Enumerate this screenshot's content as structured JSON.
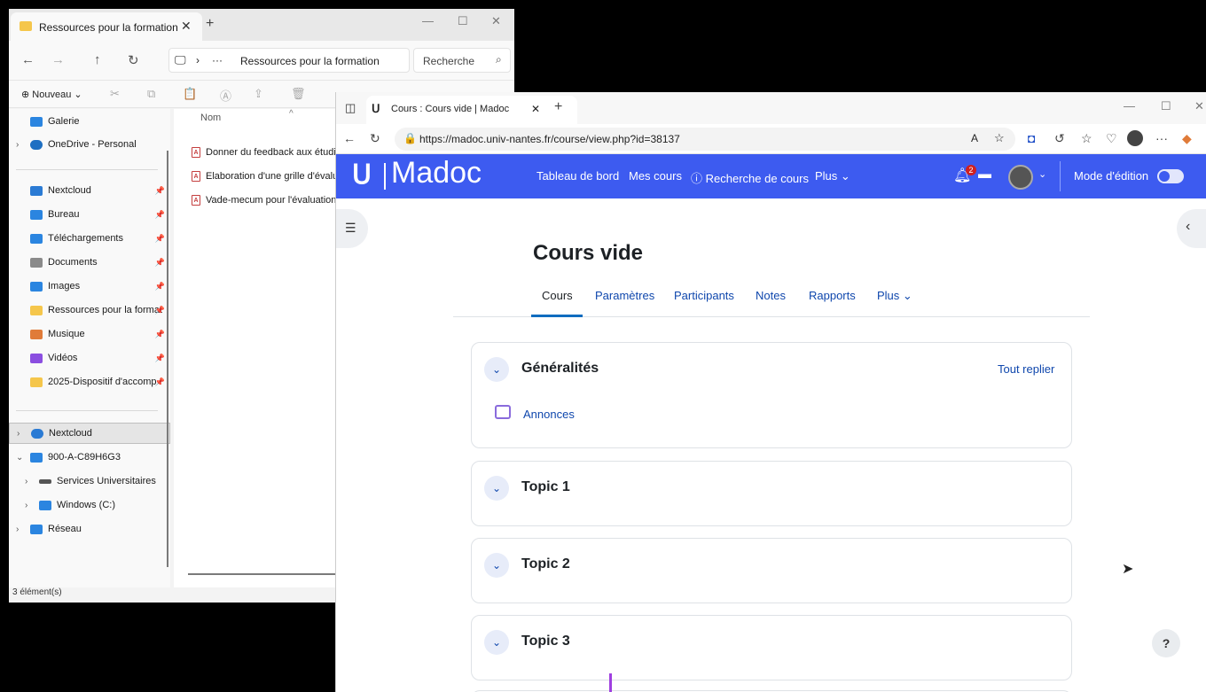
{
  "explorer": {
    "tab_title": "Ressources pour la formation",
    "breadcrumb": "Ressources pour la formation",
    "search_placeholder": "Recherche",
    "toolbar": {
      "new_label": "Nouveau"
    },
    "sidebar": {
      "gallery": "Galerie",
      "onedrive": "OneDrive - Personal",
      "quick": [
        {
          "label": "Nextcloud",
          "color": "#2b7bd4"
        },
        {
          "label": "Bureau",
          "color": "#2b85e0"
        },
        {
          "label": "Téléchargements",
          "color": "#2b85e0"
        },
        {
          "label": "Documents",
          "color": "#8a8a8a"
        },
        {
          "label": "Images",
          "color": "#2b85e0"
        },
        {
          "label": "Ressources pour la format",
          "color": "#f5c64b"
        },
        {
          "label": "Musique",
          "color": "#e07b39"
        },
        {
          "label": "Vidéos",
          "color": "#8b4ee0"
        },
        {
          "label": "2025-Dispositif d'accomp",
          "color": "#f5c64b"
        }
      ],
      "tree": {
        "nextcloud": "Nextcloud",
        "pc": "900-A-C89H6G3",
        "services": "Services Universitaires",
        "windows": "Windows (C:)",
        "network": "Réseau"
      }
    },
    "column_header": "Nom",
    "files": [
      "Donner du feedback aux étudian",
      "Elaboration d'une grille d'évalua",
      "Vade-mecum pour l'évaluation à"
    ],
    "status": "3 élément(s)"
  },
  "browser": {
    "tab_title": "Cours : Cours vide | Madoc",
    "url": "https://madoc.univ-nantes.fr/course/view.php?id=38137"
  },
  "madoc": {
    "logo_mark": "ᑌ",
    "logo_text": "Madoc",
    "nav": {
      "dashboard": "Tableau de bord",
      "my_courses": "Mes cours",
      "course_search": "Recherche de cours",
      "more": "Plus ⌄"
    },
    "notif_count": "2",
    "edit_mode": "Mode d'édition",
    "course_title": "Cours vide",
    "tabs": [
      "Cours",
      "Paramètres",
      "Participants",
      "Notes",
      "Rapports",
      "Plus ⌄"
    ],
    "sections": [
      {
        "title": "Généralités"
      },
      {
        "title": "Topic 1"
      },
      {
        "title": "Topic 2"
      },
      {
        "title": "Topic 3"
      }
    ],
    "collapse_all": "Tout replier",
    "forum_link": "Annonces",
    "help": "?"
  },
  "colors": {
    "madoc_blue": "#3d5bf0",
    "link": "#0f47ad"
  }
}
